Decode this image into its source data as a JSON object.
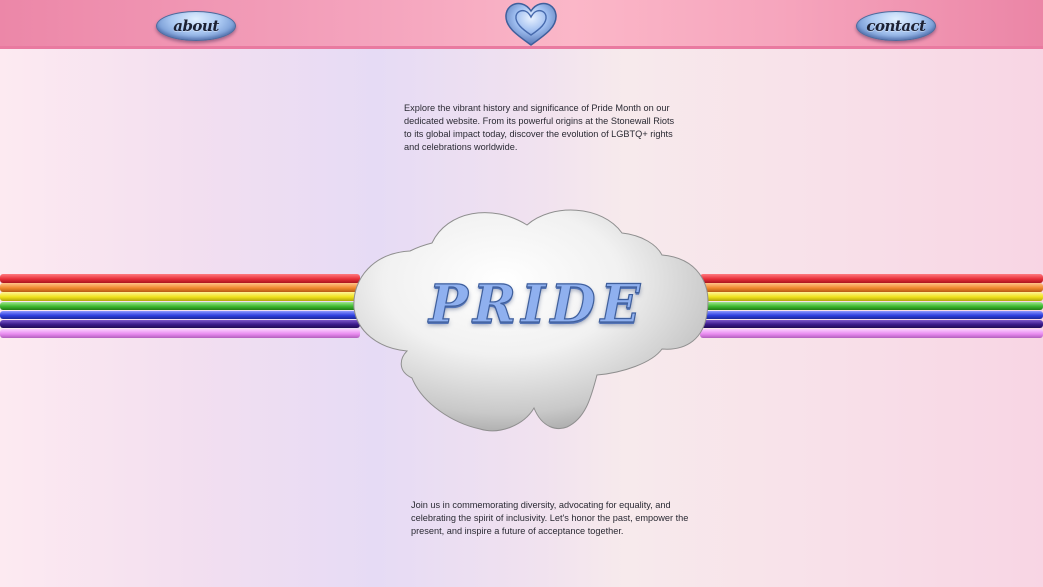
{
  "nav": {
    "about_label": "about",
    "contact_label": "contact",
    "logo_icon": "heart-icon"
  },
  "hero": {
    "title": "PRIDE",
    "cloud_icon": "cloud-icon"
  },
  "content": {
    "intro": "Explore the vibrant history and significance of Pride Month on our dedicated website. From its powerful origins at the Stonewall Riots to its global impact today, discover the evolution of LGBTQ+ rights and celebrations worldwide.",
    "outro": "Join us in commemorating diversity, advocating for equality, and celebrating the spirit of inclusivity. Let's honor the past, empower the present, and inspire a future of acceptance together."
  },
  "colors": {
    "header": "#f4a3bd",
    "button": "#a9c7f1",
    "title": "#8fb0ef",
    "rainbow": [
      "#e8303a",
      "#f0892e",
      "#f0e21a",
      "#3eb92f",
      "#2f40e0",
      "#3b1a8a",
      "#e98cf0"
    ]
  }
}
